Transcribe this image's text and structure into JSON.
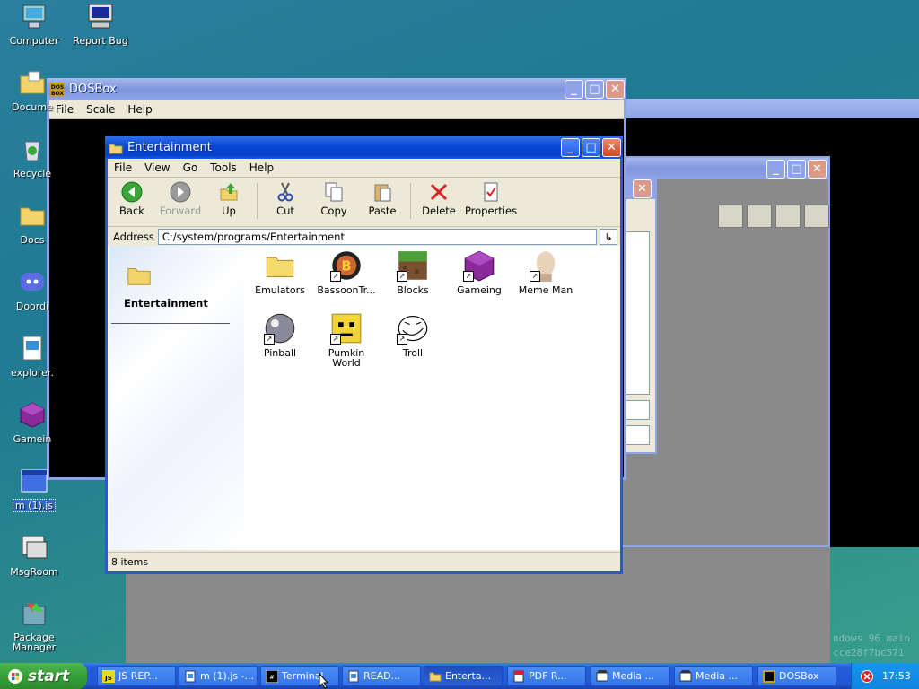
{
  "desktop": {
    "icons": [
      {
        "label": "Computer"
      },
      {
        "label": "Report Bug"
      },
      {
        "label": "Docume"
      },
      {
        "label": "Recycle"
      },
      {
        "label": "Docs"
      },
      {
        "label": "Doordi"
      },
      {
        "label": "explorer."
      },
      {
        "label": "Gamein"
      },
      {
        "label": "m (1).js"
      },
      {
        "label": "MsgRoom"
      },
      {
        "label": "Package Manager"
      }
    ],
    "watermark": [
      "ndows 96 main",
      "cce28f7bc571"
    ]
  },
  "dosbox": {
    "title": "DOSBox",
    "menu": [
      "File",
      "Scale",
      "Help"
    ]
  },
  "explorer": {
    "title": "Entertainment",
    "menu": [
      "File",
      "View",
      "Go",
      "Tools",
      "Help"
    ],
    "toolbar": {
      "back": "Back",
      "forward": "Forward",
      "up": "Up",
      "cut": "Cut",
      "copy": "Copy",
      "paste": "Paste",
      "delete": "Delete",
      "properties": "Properties"
    },
    "address_label": "Address",
    "address_value": "C:/system/programs/Entertainment",
    "sidebar_title": "Entertainment",
    "items": [
      {
        "label": "Emulators"
      },
      {
        "label": "BassoonTr..."
      },
      {
        "label": "Blocks"
      },
      {
        "label": "Gameing"
      },
      {
        "label": "Meme Man"
      },
      {
        "label": "Pinball"
      },
      {
        "label": "Pumkin World"
      },
      {
        "label": "Troll"
      }
    ],
    "status": "8 items"
  },
  "taskbar": {
    "start_label": "start",
    "tasks": [
      {
        "label": "JS REP..."
      },
      {
        "label": "m (1).js -..."
      },
      {
        "label": "Terminal"
      },
      {
        "label": "READ..."
      },
      {
        "label": "Enterta..."
      },
      {
        "label": "PDF R..."
      },
      {
        "label": "Media ..."
      },
      {
        "label": "Media ..."
      },
      {
        "label": "DOSBox"
      }
    ],
    "clock": "17:53"
  }
}
